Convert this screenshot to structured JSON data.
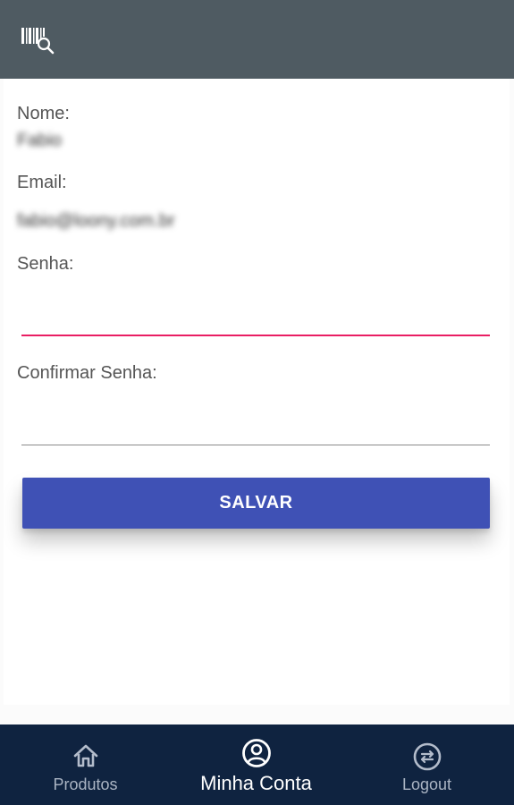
{
  "appbar": {
    "icon": "barcode-search-icon",
    "background": "#4f5b62"
  },
  "form": {
    "nome_label": "Nome:",
    "nome_value": "Fabio",
    "email_label": "Email:",
    "email_value": "fabio@loony.com.br",
    "senha_label": "Senha:",
    "senha_value": "",
    "confirmar_label": "Confirmar Senha:",
    "confirmar_value": "",
    "focused_color": "#e91e63",
    "underline_color": "#8a8a8a"
  },
  "save_button": {
    "label": "SALVAR",
    "color": "#3f51b5"
  },
  "bottom_nav": {
    "background": "#0f2340",
    "items": [
      {
        "label": "Produtos",
        "icon": "home-icon",
        "active": false
      },
      {
        "label": "Minha Conta",
        "icon": "account-circle-icon",
        "active": true
      },
      {
        "label": "Logout",
        "icon": "swap-arrows-icon",
        "active": false
      }
    ]
  }
}
